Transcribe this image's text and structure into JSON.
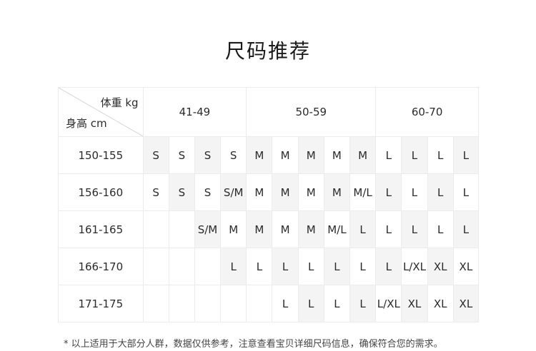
{
  "title": "尺码推荐",
  "table": {
    "corner_weight": "体重 kg",
    "corner_height": "身高 cm",
    "weight_ranges": [
      "41-49",
      "50-59",
      "60-70"
    ],
    "rows": [
      {
        "height": "150-155",
        "sizes": [
          "S",
          "S",
          "S",
          "S",
          "M",
          "M",
          "M",
          "M",
          "M",
          "L",
          "L",
          "L",
          "L"
        ]
      },
      {
        "height": "156-160",
        "sizes": [
          "S",
          "S",
          "S",
          "S/M",
          "M",
          "M",
          "M",
          "M",
          "M/L",
          "L",
          "L",
          "L",
          "L"
        ]
      },
      {
        "height": "161-165",
        "sizes": [
          "",
          "",
          "S/M",
          "M",
          "M",
          "M",
          "M",
          "M/L",
          "L",
          "L",
          "L",
          "L",
          "L"
        ]
      },
      {
        "height": "166-170",
        "sizes": [
          "",
          "",
          "",
          "L",
          "L",
          "L",
          "L",
          "L",
          "L",
          "L",
          "L/XL",
          "XL",
          "XL"
        ]
      },
      {
        "height": "171-175",
        "sizes": [
          "",
          "",
          "",
          "",
          "",
          "L",
          "L",
          "L",
          "L",
          "L/XL",
          "XL",
          "XL",
          "XL"
        ]
      }
    ]
  },
  "note": "* 以上适用于大部分人群，数据仅供参考，注意查看宝贝详细尺码信息，确保符合您的需求。"
}
